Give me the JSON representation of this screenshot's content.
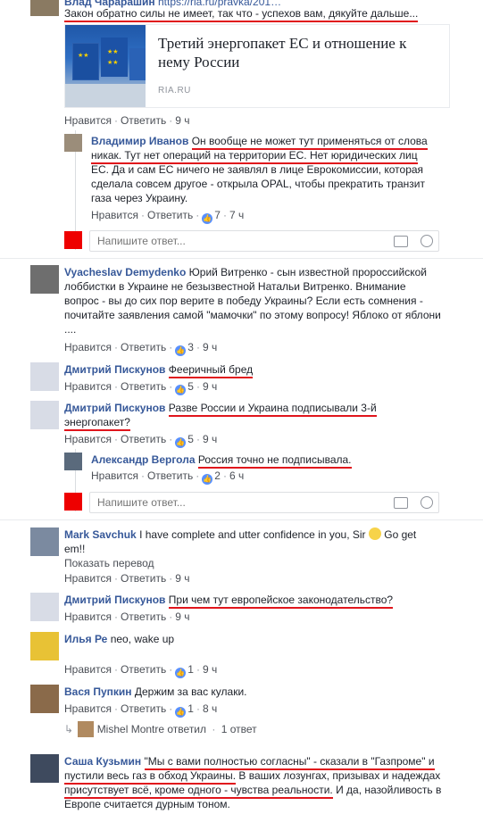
{
  "top_comment": {
    "author": "Влад Чарарашин",
    "link_text": "https://ria.ru/pravka/201…",
    "text": "Закон обратно силы не имеет, так что - успехов вам, дякуйте дальше...",
    "card": {
      "title": "Третий энергопакет ЕС и отношение к нему России",
      "source": "RIA.RU"
    },
    "actions": {
      "like": "Нравится",
      "reply": "Ответить",
      "time": "9 ч"
    }
  },
  "reply_ivanov": {
    "author": "Владимир Иванов",
    "line1": "Он вообще не может тут применяться от слова",
    "line2": "никак. Тут нет операций на территории ЕС. Нет юридических лиц",
    "line3": "ЕС. Да и сам ЕС ничего не заявлял в лице Еврокомиссии, которая",
    "line4": "сделала совсем другое - открыла OPAL, чтобы прекратить транзит",
    "line5": "газа через Украину.",
    "actions": {
      "like": "Нравится",
      "reply": "Ответить",
      "likes": "7",
      "time": "7 ч"
    }
  },
  "reply_box_1": {
    "placeholder": "Напишите ответ..."
  },
  "comment_demydenko": {
    "author": "Vyacheslav Demydenko",
    "line1": "Юрий Витренко - сын известной пророссийской",
    "line2": "лоббистки в Украине не безызвестной Натальи Витренко. Внимание",
    "line3": "вопрос - вы до сих пор верите в победу Украины? Если есть сомнения -",
    "line4": "почитайте заявления самой \"мамочки\" по этому вопросу! Яблоко от яблони",
    "line5": "....",
    "actions": {
      "like": "Нравится",
      "reply": "Ответить",
      "likes": "3",
      "time": "9 ч"
    }
  },
  "comment_piskunov_1": {
    "author": "Дмитрий Пискунов",
    "text": "Фееричный бред",
    "actions": {
      "like": "Нравится",
      "reply": "Ответить",
      "likes": "5",
      "time": "9 ч"
    }
  },
  "comment_piskunov_2": {
    "author": "Дмитрий Пискунов",
    "line1": "Разве России и Украина подписывали 3-й",
    "line2": "энергопакет?",
    "actions": {
      "like": "Нравится",
      "reply": "Ответить",
      "likes": "5",
      "time": "9 ч"
    }
  },
  "reply_vergola": {
    "author": "Александр Вергола",
    "text": "Россия точно не подписывала.",
    "actions": {
      "like": "Нравится",
      "reply": "Ответить",
      "likes": "2",
      "time": "6 ч"
    }
  },
  "reply_box_2": {
    "placeholder": "Напишите ответ..."
  },
  "comment_savchuk": {
    "author": "Mark Savchuk",
    "line1": "I have complete and utter confidence in you, Sir",
    "line1b": "Go get",
    "line2": "em!!",
    "translate": "Показать перевод",
    "actions": {
      "like": "Нравится",
      "reply": "Ответить",
      "time": "9 ч"
    }
  },
  "comment_piskunov_3": {
    "author": "Дмитрий Пискунов",
    "text": "При чем тут европейское законодательство?",
    "actions": {
      "like": "Нравится",
      "reply": "Ответить",
      "time": "9 ч"
    }
  },
  "comment_ilya": {
    "author": "Илья Ре",
    "text": "neo, wake up",
    "actions": {
      "like": "Нравится",
      "reply": "Ответить",
      "likes": "1",
      "time": "9 ч"
    }
  },
  "comment_vasya": {
    "author": "Вася Пупкин",
    "text": "Держим за вас кулаки.",
    "actions": {
      "like": "Нравится",
      "reply": "Ответить",
      "likes": "1",
      "time": "8 ч"
    },
    "reply_summary": {
      "name": "Mishel Montre",
      "verb": "ответил",
      "count": "1 ответ"
    }
  },
  "comment_kuzmin": {
    "author": "Саша Кузьмин",
    "line1": "\"Мы с вами полностью согласны\" - сказали в \"Газпроме\" и",
    "line2a": "пустили весь газ в обход Украины.",
    "line2b": " В ваших лозунгах, призывах и надеждах",
    "line3a": "присутствует всё, кроме одного - чувства реальности.",
    "line3b": " И да, назойливость в",
    "line4": "Европе считается дурным тоном."
  },
  "colors": {
    "link": "#365899",
    "underline": "#e0151c",
    "like_icon": "#5890ff"
  }
}
